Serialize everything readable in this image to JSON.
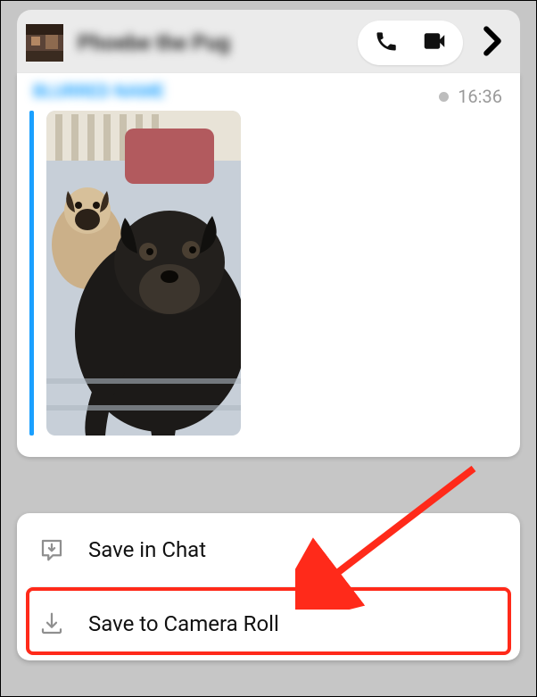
{
  "header": {
    "contact_name": "Phoebe the Pug",
    "icons": {
      "call": "phone-icon",
      "video": "video-icon",
      "more": "chevron-right-icon"
    }
  },
  "chat": {
    "sender": "BLURRED NAME",
    "timestamp": "16:36"
  },
  "menu": {
    "save_chat_label": "Save in Chat",
    "save_camera_roll_label": "Save to Camera Roll"
  }
}
